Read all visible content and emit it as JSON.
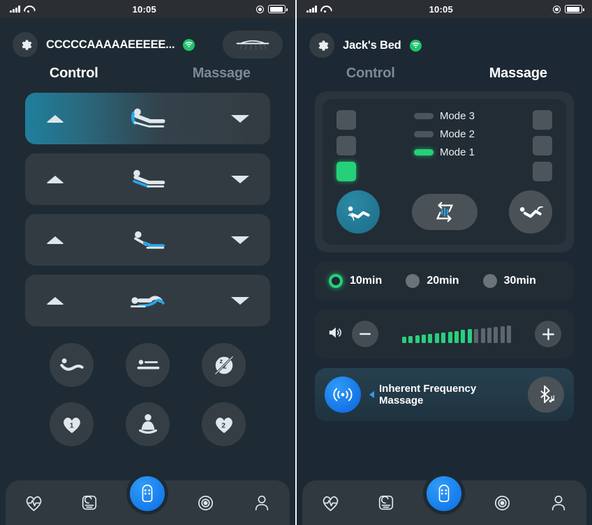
{
  "status_bar": {
    "time": "10:05",
    "signal_icon": "cellular-bars-icon",
    "wifi_icon": "wifi-icon",
    "lock_icon": "rotation-lock-icon",
    "battery_icon": "battery-icon"
  },
  "left_panel": {
    "header": {
      "gear_icon": "gear-icon",
      "device_name": "CCCCCAAAAAEEEEE...",
      "connection_icon": "wifi-connected-icon",
      "bed_icon": "bed-remote-icon"
    },
    "tabs": [
      {
        "label": "Control",
        "active": true
      },
      {
        "label": "Massage",
        "active": false
      }
    ],
    "control_rows": [
      {
        "name": "head-position",
        "up_icon": "triangle-up-icon",
        "bed_icon": "bed-head-raised-icon",
        "down_icon": "triangle-down-icon",
        "highlighted": true
      },
      {
        "name": "back-position",
        "up_icon": "triangle-up-icon",
        "bed_icon": "bed-back-raised-icon",
        "down_icon": "triangle-down-icon",
        "highlighted": false
      },
      {
        "name": "foot-position",
        "up_icon": "triangle-up-icon",
        "bed_icon": "bed-foot-raised-icon",
        "down_icon": "triangle-down-icon",
        "highlighted": false
      },
      {
        "name": "lumbar-position",
        "up_icon": "triangle-up-icon",
        "bed_icon": "bed-lumbar-wave-icon",
        "down_icon": "triangle-down-icon",
        "highlighted": false
      }
    ],
    "presets": [
      {
        "name": "zero-gravity-preset",
        "icon": "zero-gravity-icon"
      },
      {
        "name": "flat-preset",
        "icon": "flat-bed-icon"
      },
      {
        "name": "anti-snore-preset",
        "icon": "anti-snore-icon"
      },
      {
        "name": "memory-1-preset",
        "icon": "heart-icon",
        "label": "1"
      },
      {
        "name": "meditation-preset",
        "icon": "meditation-pose-icon"
      },
      {
        "name": "memory-2-preset",
        "icon": "heart-icon",
        "label": "2"
      }
    ]
  },
  "right_panel": {
    "header": {
      "gear_icon": "gear-icon",
      "device_name": "Jack's Bed",
      "connection_icon": "wifi-connected-icon"
    },
    "tabs": [
      {
        "label": "Control",
        "active": false
      },
      {
        "label": "Massage",
        "active": true
      }
    ],
    "mode_panel": {
      "mode_labels": [
        "Mode 3",
        "Mode 2",
        "Mode 1"
      ],
      "head_leds": [
        false,
        false,
        true
      ],
      "sync_leds": [
        false,
        false,
        true
      ],
      "foot_leds": [
        false,
        false,
        false
      ],
      "buttons": [
        {
          "name": "head-massage-button",
          "icon": "head-massage-icon",
          "active": true
        },
        {
          "name": "sync-massage-button",
          "icon": "sync-wave-icon",
          "active": false
        },
        {
          "name": "foot-massage-button",
          "icon": "foot-massage-icon",
          "active": false
        }
      ]
    },
    "timer": {
      "options": [
        {
          "label": "10min",
          "selected": true
        },
        {
          "label": "20min",
          "selected": false
        },
        {
          "label": "30min",
          "selected": false
        }
      ]
    },
    "intensity": {
      "speaker_icon": "speaker-icon",
      "minus_icon": "minus-icon",
      "plus_icon": "plus-icon",
      "level": 11,
      "total": 17
    },
    "frequency_bar": {
      "broadcast_icon": "broadcast-icon",
      "chevron_icon": "chevron-left-icon",
      "label": "Inherent Frequency Massage",
      "bluetooth_icon": "bluetooth-audio-icon"
    }
  },
  "bottom_nav": [
    {
      "name": "nav-health",
      "icon": "heart-pulse-icon",
      "active": false
    },
    {
      "name": "nav-sleep",
      "icon": "sleep-moon-icon",
      "active": false
    },
    {
      "name": "nav-remote",
      "icon": "remote-control-icon",
      "active": true
    },
    {
      "name": "nav-scenes",
      "icon": "target-circle-icon",
      "active": false
    },
    {
      "name": "nav-profile",
      "icon": "person-icon",
      "active": false
    }
  ]
}
